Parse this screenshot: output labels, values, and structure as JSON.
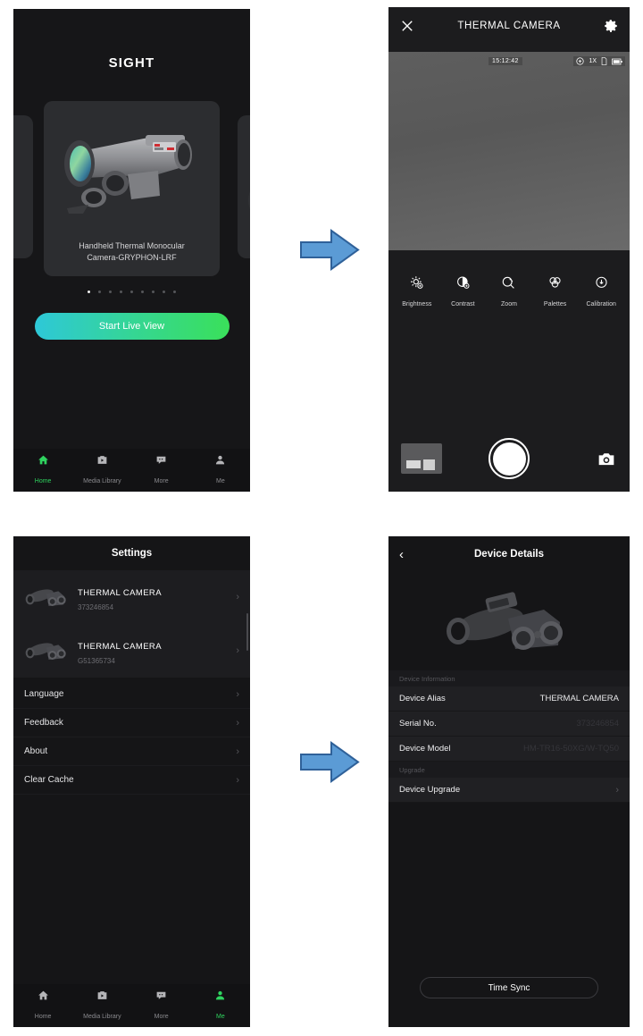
{
  "home": {
    "app_title": "SIGHT",
    "carousel": {
      "caption_line1": "Handheld Thermal Monocular",
      "caption_line2": "Camera-GRYPHON-LRF",
      "dot_count": 9,
      "active_dot": 0
    },
    "live_button": "Start Live View",
    "accent_start": "#2ec8d8",
    "accent_end": "#3ae05a"
  },
  "tabbar": {
    "active_color": "#2fd35f",
    "items": [
      {
        "label": "Home",
        "icon": "home-icon"
      },
      {
        "label": "Media Library",
        "icon": "media-library-icon"
      },
      {
        "label": "More",
        "icon": "more-icon"
      },
      {
        "label": "Me",
        "icon": "me-icon"
      }
    ]
  },
  "live_view": {
    "title": "THERMAL CAMERA",
    "close_icon": "close-icon",
    "settings_icon": "gear-icon",
    "osd": {
      "timestamp": "15:12:42",
      "zoom_level": "1X",
      "wifi_icon": "wifi-icon",
      "sdcard_icon": "sdcard-icon",
      "battery_icon": "battery-icon"
    },
    "tools": [
      {
        "label": "Brightness",
        "icon": "brightness-icon"
      },
      {
        "label": "Contrast",
        "icon": "contrast-icon"
      },
      {
        "label": "Zoom",
        "icon": "zoom-icon"
      },
      {
        "label": "Palettes",
        "icon": "palettes-icon"
      },
      {
        "label": "Calibration",
        "icon": "calibration-icon"
      }
    ],
    "thumbnail_name": "last-capture-thumbnail",
    "shutter_name": "shutter-button",
    "camera_toggle_icon": "photo-mode-icon"
  },
  "settings": {
    "title": "Settings",
    "devices": [
      {
        "name": "THERMAL CAMERA",
        "serial": "G51365734"
      },
      {
        "name": "THERMAL CAMERA",
        "serial": "373246854"
      }
    ],
    "menu": [
      {
        "label": "Language"
      },
      {
        "label": "Feedback"
      },
      {
        "label": "About"
      },
      {
        "label": "Clear Cache"
      }
    ],
    "chevron": "›"
  },
  "device_details": {
    "title": "Device Details",
    "back_icon": "chevron-left-icon",
    "sections": [
      {
        "heading": "Device Information",
        "rows": [
          {
            "key": "Device Alias",
            "value": "THERMAL CAMERA",
            "dim": false
          },
          {
            "key": "Serial No.",
            "value": "373246854",
            "dim": true
          },
          {
            "key": "Device Model",
            "value": "HM-TR16-50XG/W-TQ50",
            "dim": true
          }
        ]
      },
      {
        "heading": "Upgrade",
        "rows": [
          {
            "key": "Device Upgrade",
            "value": "",
            "dim": false
          }
        ]
      }
    ],
    "time_sync_button": "Time Sync"
  },
  "arrows": {
    "fill": "#5b9bd5",
    "stroke": "#2f6199",
    "count": 2
  }
}
